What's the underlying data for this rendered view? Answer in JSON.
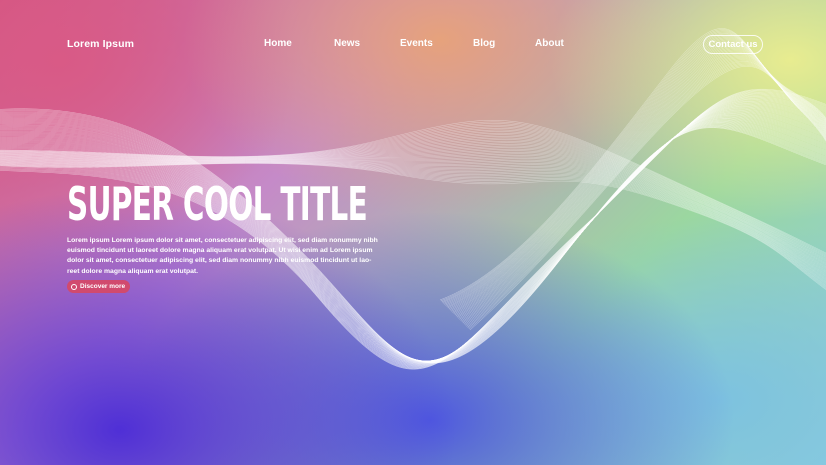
{
  "brand": "Lorem Ipsum",
  "nav": {
    "links": [
      "Home",
      "News",
      "Events",
      "Blog",
      "About"
    ],
    "contact_label": "Contact us"
  },
  "hero": {
    "title": "SUPER COOL TITLE",
    "body": "Lorem ipsum Lorem ipsum dolor sit amet, consectetuer adipiscing elit, sed diam nonummy nibh euismod tincidunt ut laoreet dolore magna aliquam erat volutpat. Ut wisi enim ad Lorem ipsum dolor sit amet, consectetuer adipiscing elit, sed diam nonummy nibh euismod tincidunt ut lao-reet dolore magna aliquam erat volutpat.",
    "button_label": "Discover more",
    "button_icon": "circle-arrow-icon"
  },
  "colors": {
    "top_left": "#d95a86",
    "top_center": "#e6a27c",
    "top_right": "#e8ec90",
    "bottom_left": "#4f2fd6",
    "bottom_center": "#4e58e0",
    "bottom_right": "#7dc2e0",
    "button": "#d14a6e",
    "text": "#ffffff"
  }
}
